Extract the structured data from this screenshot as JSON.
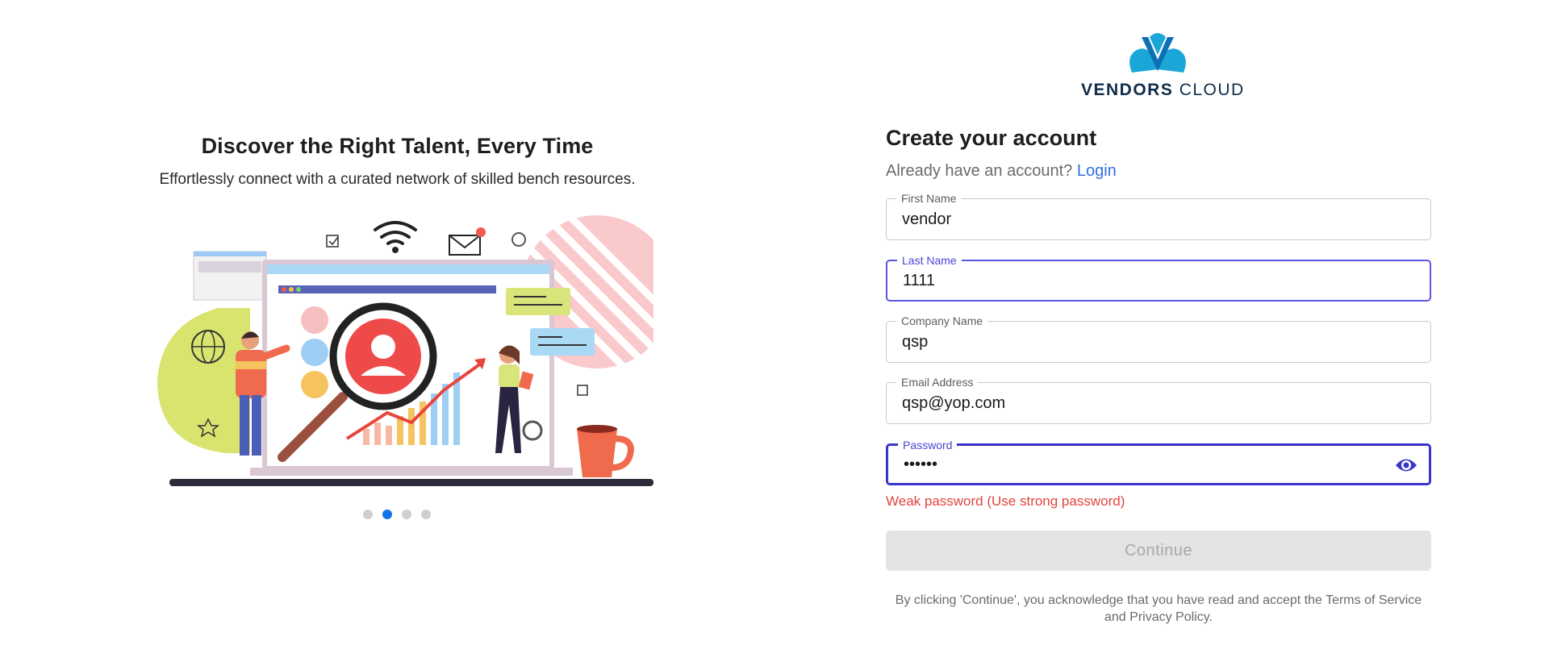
{
  "hero": {
    "title": "Discover the Right Talent, Every Time",
    "subtitle": "Effortlessly connect with a curated network of skilled bench resources.",
    "illustration": "talent-search-illustration",
    "carousel": {
      "total": 4,
      "active_index": 2
    }
  },
  "brand": {
    "name_bold": "VENDORS",
    "name_light": "CLOUD",
    "logo_colors": [
      "#1aa7d8",
      "#0e6fb3",
      "#0f2d4a"
    ]
  },
  "form": {
    "title": "Create your account",
    "already_text": "Already have an account?",
    "login_link": "Login",
    "fields": {
      "first_name": {
        "label": "First Name",
        "value": "vendor"
      },
      "last_name": {
        "label": "Last Name",
        "value": "1111"
      },
      "company_name": {
        "label": "Company Name",
        "value": "qsp"
      },
      "email": {
        "label": "Email Address",
        "value": "qsp@yop.com"
      },
      "password": {
        "label": "Password",
        "value": "••••••",
        "toggle_icon": "eye-icon"
      }
    },
    "password_error": "Weak password (Use strong password)",
    "continue_label": "Continue",
    "terms_text": "By clicking 'Continue', you acknowledge that you have read and accept the Terms of Service and Privacy Policy."
  },
  "colors": {
    "accent": "#4b45d6",
    "link": "#2f6fe0",
    "error": "#e0443e",
    "carousel_active": "#1473e6"
  }
}
